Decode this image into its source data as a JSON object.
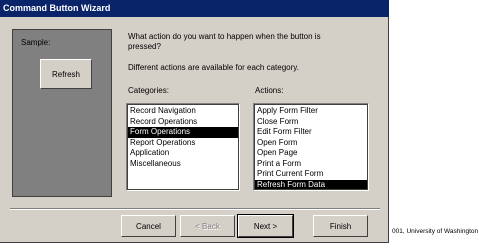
{
  "window": {
    "title": "Command Button Wizard"
  },
  "sample": {
    "label": "Sample:",
    "button_label": "Refresh"
  },
  "prompt": {
    "question": "What action do you want to happen when the button is pressed?",
    "subtext": "Different actions are available for each category."
  },
  "categories": {
    "label": "Categories:",
    "items": [
      "Record Navigation",
      "Record Operations",
      "Form Operations",
      "Report Operations",
      "Application",
      "Miscellaneous"
    ],
    "selected": "Form Operations"
  },
  "actions": {
    "label": "Actions:",
    "items": [
      "Apply Form Filter",
      "Close Form",
      "Edit Form Filter",
      "Open Form",
      "Open Page",
      "Print a Form",
      "Print Current Form",
      "Refresh Form Data"
    ],
    "selected": "Refresh Form Data"
  },
  "buttons": {
    "cancel": "Cancel",
    "back": "< Back",
    "next": "Next >",
    "finish": "Finish"
  },
  "footer": {
    "copyright": "001, University of Washington"
  }
}
